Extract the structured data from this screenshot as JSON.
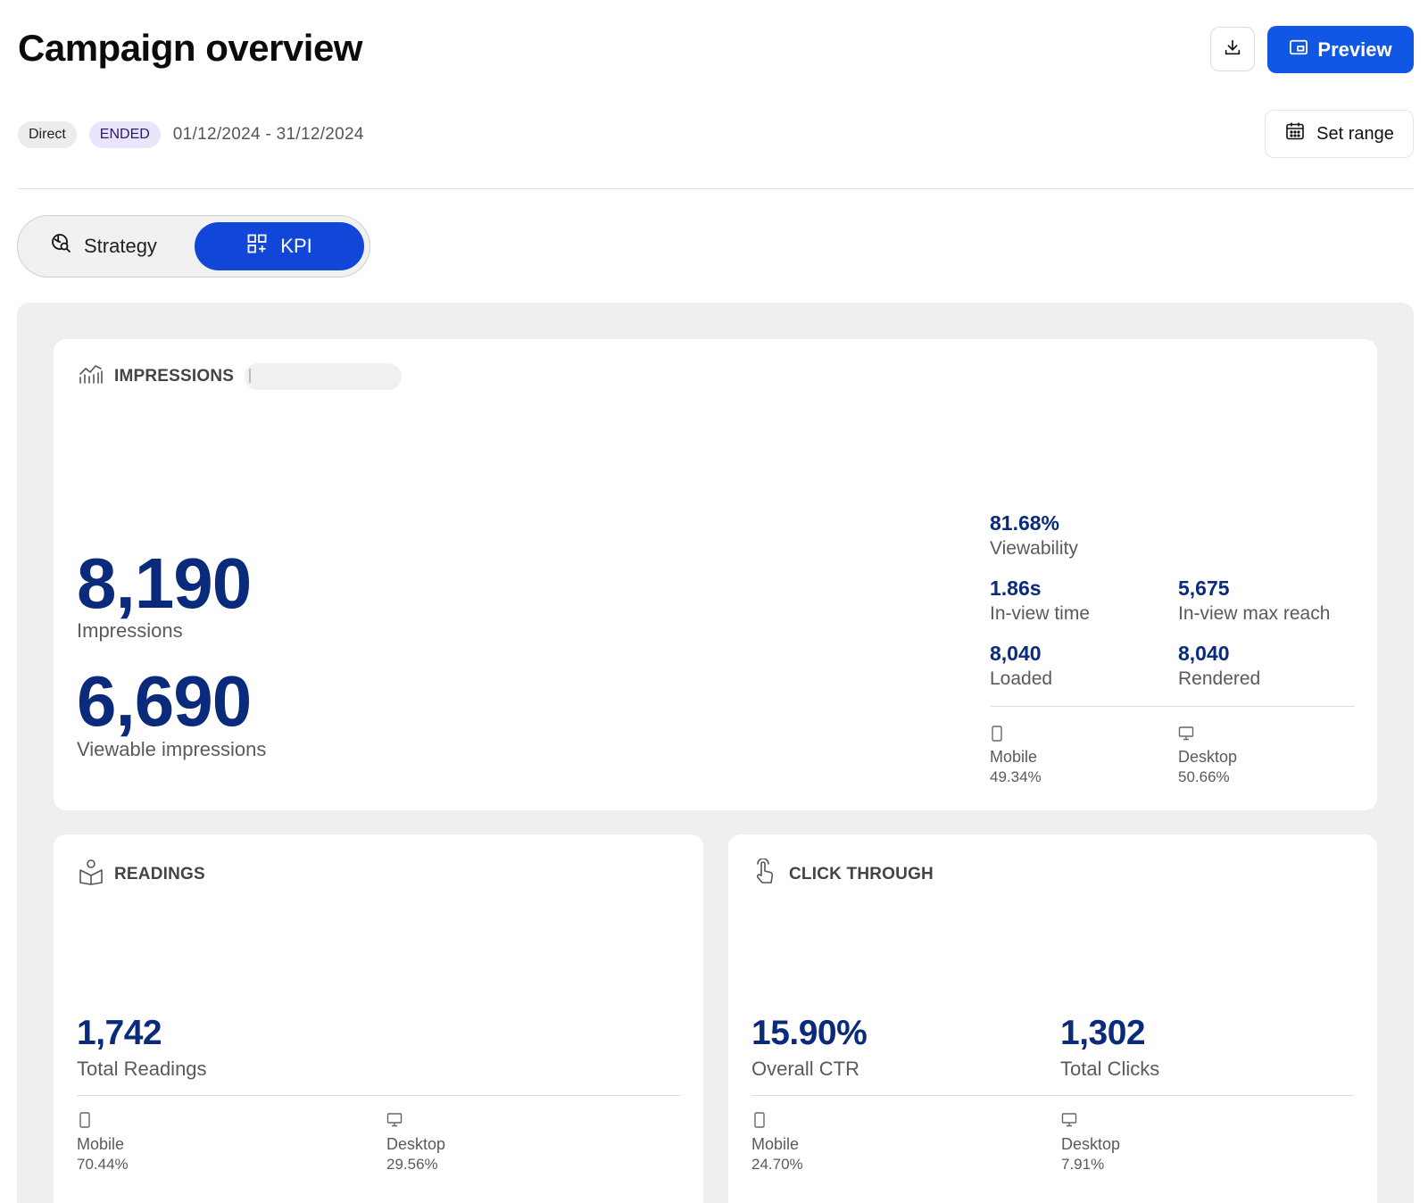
{
  "header": {
    "title": "Campaign overview",
    "download_icon": "download-icon",
    "preview_label": "Preview",
    "preview_icon": "preview-window-icon",
    "accent_color": "#1157e6"
  },
  "meta": {
    "badge_direct": "Direct",
    "badge_status": "ENDED",
    "date_range": "01/12/2024 - 31/12/2024",
    "set_range_label": "Set range",
    "calendar_icon": "calendar-icon"
  },
  "tabs": [
    {
      "label": "Strategy",
      "icon": "strategy-search-icon",
      "active": false
    },
    {
      "label": "KPI",
      "icon": "kpi-grid-icon",
      "active": true
    }
  ],
  "impressions": {
    "heading": "IMPRESSIONS",
    "icon": "chart-bars-icon",
    "total_value": "8,190",
    "total_label": "Impressions",
    "viewable_value": "6,690",
    "viewable_label": "Viewable impressions",
    "viewability_value": "81.68%",
    "viewability_label": "Viewability",
    "inview_time_value": "1.86s",
    "inview_time_label": "In-view time",
    "inview_reach_value": "5,675",
    "inview_reach_label": "In-view max reach",
    "loaded_value": "8,040",
    "loaded_label": "Loaded",
    "rendered_value": "8,040",
    "rendered_label": "Rendered",
    "mobile_label": "Mobile",
    "mobile_value": "49.34%",
    "desktop_label": "Desktop",
    "desktop_value": "50.66%"
  },
  "readings": {
    "heading": "READINGS",
    "icon": "reader-icon",
    "total_value": "1,742",
    "total_label": "Total Readings",
    "mobile_label": "Mobile",
    "mobile_value": "70.44%",
    "desktop_label": "Desktop",
    "desktop_value": "29.56%"
  },
  "click_through": {
    "heading": "CLICK THROUGH",
    "icon": "pointer-click-icon",
    "ctr_value": "15.90%",
    "ctr_label": "Overall CTR",
    "clicks_value": "1,302",
    "clicks_label": "Total Clicks",
    "mobile_label": "Mobile",
    "mobile_value": "24.70%",
    "desktop_label": "Desktop",
    "desktop_value": "7.91%"
  },
  "colors": {
    "metric_navy": "#0a2a7c",
    "kpi_tab": "#1147d8",
    "panel_bg": "#efefef"
  }
}
